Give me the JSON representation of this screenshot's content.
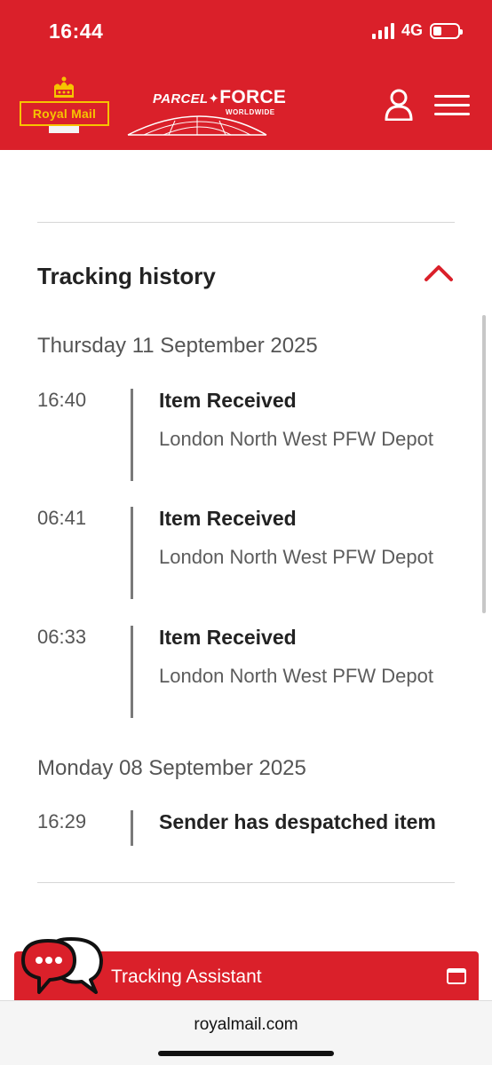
{
  "status_bar": {
    "time": "16:44",
    "network": "4G",
    "battery_percent": 20
  },
  "header": {
    "royal_mail_logo": "Royal Mail",
    "parcelforce_logo": {
      "main": "PARCEL",
      "force": "FORCE",
      "sub": "WORLDWIDE"
    },
    "account_icon": "user-icon",
    "menu_icon": "hamburger-menu-icon",
    "brand_color": "#da202a",
    "logo_yellow": "#f6c400"
  },
  "tracking": {
    "section_title": "Tracking history",
    "expanded": true,
    "days": [
      {
        "date": "Thursday 11 September 2025",
        "events": [
          {
            "time": "16:40",
            "title": "Item Received",
            "location": "London North West PFW Depot"
          },
          {
            "time": "06:41",
            "title": "Item Received",
            "location": "London North West PFW Depot"
          },
          {
            "time": "06:33",
            "title": "Item Received",
            "location": "London North West PFW Depot"
          }
        ]
      },
      {
        "date": "Monday 08 September 2025",
        "events": [
          {
            "time": "16:29",
            "title": "Sender has despatched item",
            "location": ""
          }
        ]
      }
    ]
  },
  "assistant": {
    "label": "Tracking Assistant",
    "icon": "chat-bubbles-icon"
  },
  "browser": {
    "url": "royalmail.com"
  }
}
